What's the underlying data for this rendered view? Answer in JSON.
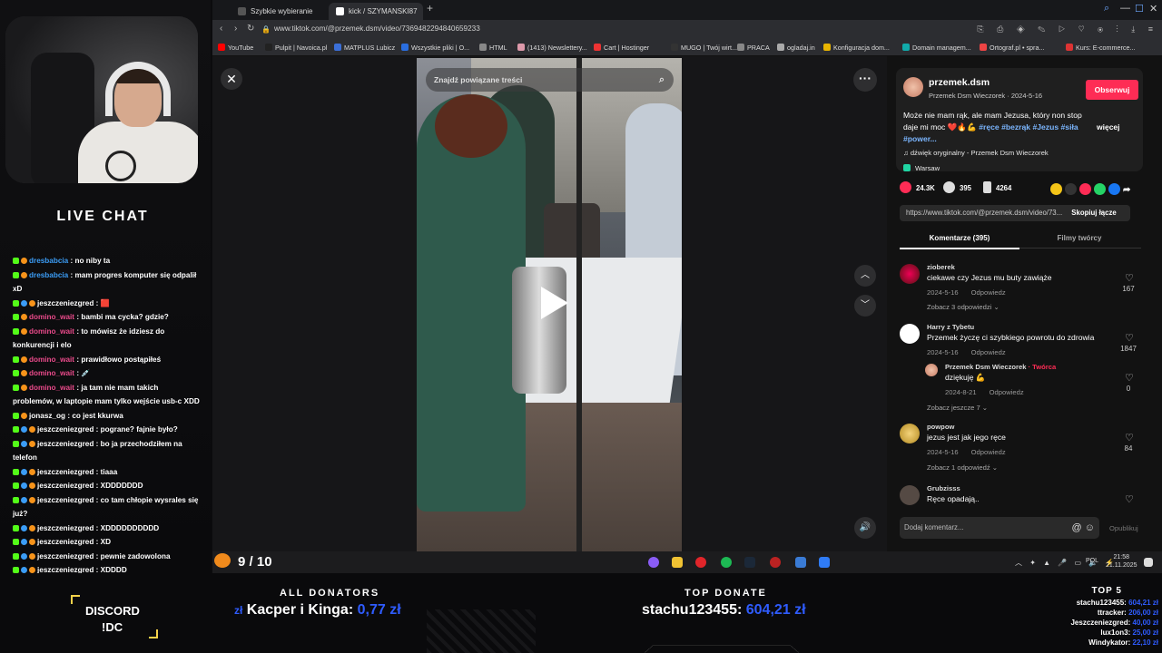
{
  "browser": {
    "tabs": [
      {
        "label": "Szybkie wybieranie"
      },
      {
        "label": "kick / SZYMANSKI87 (@"
      }
    ],
    "url": "www.tiktok.com/@przemek.dsm/video/7369482294840659233",
    "bookmarks": [
      "YouTube",
      "Pulpit | Navoica.pl",
      "MATPLUS Lubicz",
      "Wszystkie pliki | O...",
      "HTML",
      "(1413) Newslettery...",
      "Cart | Hostinger",
      "MUGO | Twój wirt...",
      "PRACA",
      "ogladaj.in",
      "Konfiguracja dom...",
      "Domain managem...",
      "Ortograf.pl • spra...",
      "Kurs: E-commerce..."
    ]
  },
  "video": {
    "search_placeholder": "Znajdź powiązane treści"
  },
  "post": {
    "author": "przemek.dsm",
    "author_sub": "Przemek Dsm Wieczorek · 2024-5-16",
    "follow_label": "Obserwuj",
    "description": "Może nie mam rąk, ale mam Jezusa, który non stop daje mi moc ❤️🔥💪",
    "tags": "#ręce #bezrąk #Jezus #siła #power...",
    "more_label": "więcej",
    "sound": "dźwięk oryginalny - Przemek Dsm Wieczorek",
    "location": "Warsaw",
    "likes": "24.3K",
    "comments_count": "395",
    "saves": "4264",
    "link": "https://www.tiktok.com/@przemek.dsm/video/73...",
    "copy_label": "Skopiuj łącze",
    "tab_comments": "Komentarze (395)",
    "tab_creator": "Filmy twórcy"
  },
  "comments": [
    {
      "name": "zioberek",
      "text": "ciekawe czy Jezus mu buty zawiąże",
      "date": "2024-5-16",
      "reply": "Odpowiedz",
      "likes": "167",
      "more": "Zobacz 3 odpowiedzi"
    },
    {
      "name": "Harry z Tybetu",
      "text": "Przemek życzę ci szybkiego powrotu do zdrowia",
      "date": "2024-5-16",
      "reply": "Odpowiedz",
      "likes": "1847"
    },
    {
      "name": "Przemek Dsm Wieczorek",
      "creator": "· Twórca",
      "text": "dziękuję 💪",
      "date": "2024-8-21",
      "reply": "Odpowiedz",
      "likes": "0",
      "more": "Zobacz jeszcze 7"
    },
    {
      "name": "powpow",
      "text": "jezus jest jak jego ręce",
      "date": "2024-5-16",
      "reply": "Odpowiedz",
      "likes": "84",
      "more": "Zobacz 1 odpowiedź"
    },
    {
      "name": "Grubzisss",
      "text": "Ręce opadają.."
    }
  ],
  "comment_input": {
    "placeholder": "Dodaj komentarz...",
    "post_label": "Opublikuj"
  },
  "chat": {
    "title": "LIVE CHAT",
    "messages": [
      {
        "user": "dresbabcia",
        "text": ": no niby ta"
      },
      {
        "user": "dresbabcia",
        "text": ": mam progres komputer się odpalił xD"
      },
      {
        "user": "jeszczeniezgred",
        "text": ": 🟥"
      },
      {
        "user": "domino_wait",
        "text": ": bambi ma cycka? gdzie?"
      },
      {
        "user": "domino_wait",
        "text": ": to mówisz że idziesz do konkurencji i elo"
      },
      {
        "user": "domino_wait",
        "text": ": prawidłowo postąpiłeś"
      },
      {
        "user": "domino_wait",
        "text": ": 💉"
      },
      {
        "user": "domino_wait",
        "text": ": ja tam nie mam takich problemów, w laptopie mam tylko wejście usb-c XDD"
      },
      {
        "user": "jonasz_og",
        "text": ": co jest kkurwa"
      },
      {
        "user": "jeszczeniezgred",
        "text": ": pograne? fajnie było?"
      },
      {
        "user": "jeszczeniezgred",
        "text": ": bo ja przechodziłem na telefon"
      },
      {
        "user": "jeszczeniezgred",
        "text": ": tiaaa"
      },
      {
        "user": "jeszczeniezgred",
        "text": ": XDDDDDDD"
      },
      {
        "user": "jeszczeniezgred",
        "text": ": co tam chłopie wysrales się już?"
      },
      {
        "user": "jeszczeniezgred",
        "text": ": XDDDDDDDDDD"
      },
      {
        "user": "jeszczeniezgred",
        "text": ": XD"
      },
      {
        "user": "jeszczeniezgred",
        "text": ": pewnie zadowolona"
      },
      {
        "user": "jeszczeniezgred",
        "text": ": XDDDD"
      }
    ]
  },
  "overlay": {
    "score": "9",
    "score_total": "/ 10",
    "discord_l1": "DISCORD",
    "discord_l2": "!DC",
    "all_donators_title": "ALL DONATORS",
    "all_donators_currency": "zł",
    "all_donators_name": "Kacper i Kinga:",
    "all_donators_amount": "0,77 zł",
    "top_donate_title": "TOP DONATE",
    "top_donate_name": "stachu123455:",
    "top_donate_amount": "604,21 zł",
    "top5_title": "TOP 5",
    "top5": [
      {
        "name": "stachu123455:",
        "amount": "604,21 zł"
      },
      {
        "name": "ttracker:",
        "amount": "206,00 zł"
      },
      {
        "name": "Jeszczeniezgred:",
        "amount": "40,00 zł"
      },
      {
        "name": "lux1on3:",
        "amount": "25,00 zł"
      },
      {
        "name": "Windykator:",
        "amount": "22,10 zł"
      }
    ]
  },
  "taskbar": {
    "lang": "POL",
    "time": "21:58",
    "date": "21.11.2025"
  }
}
